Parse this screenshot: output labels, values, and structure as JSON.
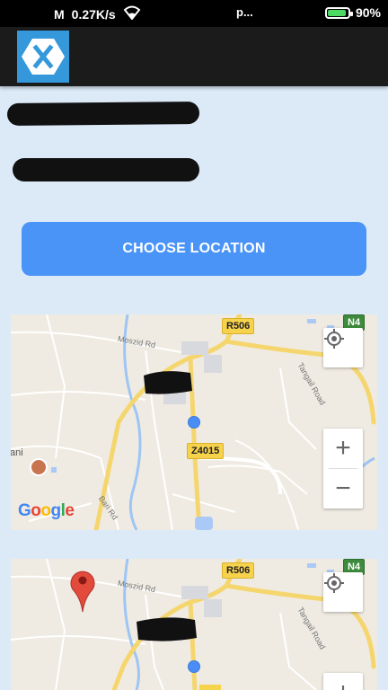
{
  "status_bar": {
    "speed": "0.27K/s",
    "battery": "90%",
    "battery_level": 0.9,
    "carrier_partial": "M",
    "center_partial": "p..."
  },
  "app_bar": {
    "logo_icon": "xamarin-logo-icon",
    "logo_color": "#3498DB"
  },
  "main": {
    "choose_button_label": "CHOOSE LOCATION"
  },
  "maps": [
    {
      "labels": {
        "r506": "R506",
        "n4": "N4",
        "z4015": "Z4015",
        "moszid": "Moszid Rd",
        "tangail": "Tangail Road",
        "bari": "Bari Rd",
        "place_partial": "ani"
      },
      "google": [
        "G",
        "o",
        "o",
        "g",
        "l",
        "e"
      ]
    },
    {
      "labels": {
        "r506": "R506",
        "n4": "N4",
        "moszid": "Moszid Rd",
        "tangail": "Tangail Road"
      }
    }
  ]
}
